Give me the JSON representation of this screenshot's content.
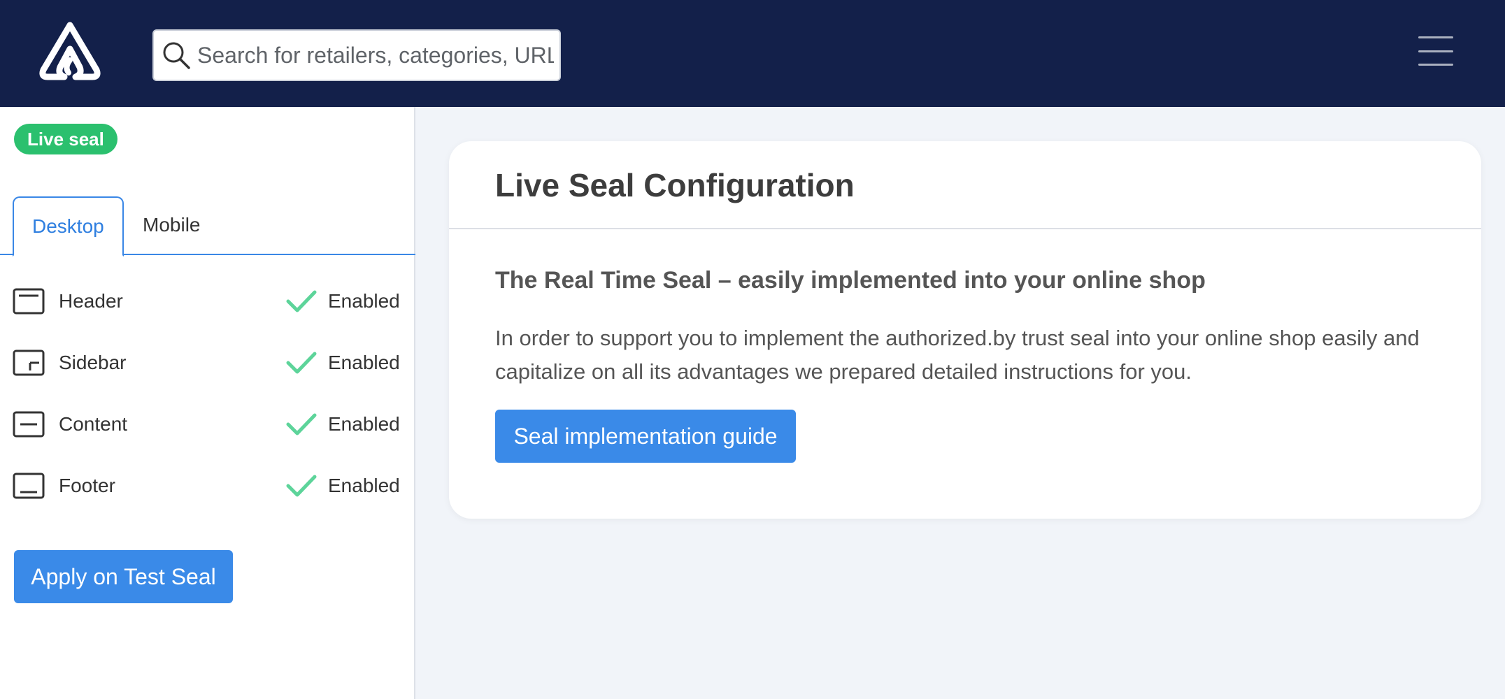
{
  "header": {
    "logo_icon": "authorized-by-logo",
    "search": {
      "placeholder": "Search for retailers, categories, URL",
      "value": ""
    },
    "menu_icon": "hamburger-menu-icon"
  },
  "sidebar": {
    "badge": "Live seal",
    "tabs": [
      {
        "label": "Desktop",
        "active": true
      },
      {
        "label": "Mobile",
        "active": false
      }
    ],
    "options": [
      {
        "label": "Header",
        "icon": "layout-header-icon",
        "status": "Enabled"
      },
      {
        "label": "Sidebar",
        "icon": "layout-sidebar-icon",
        "status": "Enabled"
      },
      {
        "label": "Content",
        "icon": "layout-content-icon",
        "status": "Enabled"
      },
      {
        "label": "Footer",
        "icon": "layout-footer-icon",
        "status": "Enabled"
      }
    ],
    "apply_button": "Apply on Test Seal"
  },
  "card": {
    "title": "Live Seal Configuration",
    "subtitle": "The Real Time Seal – easily implemented into your online shop",
    "body": "In order to support you to implement the authorized.by trust seal into your online shop easily and capitalize on all its advantages we prepared detailed instructions for you.",
    "button": "Seal implementation guide"
  },
  "colors": {
    "topbar": "#13204a",
    "badge": "#2bc06e",
    "primary": "#3a8ae8",
    "check": "#5dd49a",
    "background": "#f1f4f9"
  }
}
